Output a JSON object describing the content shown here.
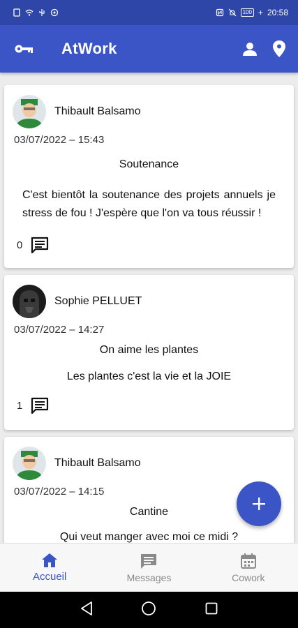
{
  "status_bar": {
    "time": "20:58",
    "battery": "100"
  },
  "app_bar": {
    "title": "AtWork"
  },
  "posts": [
    {
      "author": "Thibault Balsamo",
      "date": "03/07/2022 – 15:43",
      "title": "Soutenance",
      "body": "C'est bientôt la soutenance des projets annuels je stress de fou ! J'espère que l'on va tous réussir !",
      "comment_count": "0"
    },
    {
      "author": "Sophie PELLUET",
      "date": "03/07/2022 – 14:27",
      "title": "On aime les plantes",
      "body": "Les plantes c'est la vie et la JOIE",
      "comment_count": "1"
    },
    {
      "author": "Thibault Balsamo",
      "date": "03/07/2022 – 14:15",
      "title": "Cantine",
      "body": "Qui veut manger avec moi ce midi ?",
      "comment_count": ""
    }
  ],
  "bottom_nav": [
    {
      "label": "Accueil",
      "icon": "home-icon"
    },
    {
      "label": "Messages",
      "icon": "message-icon"
    },
    {
      "label": "Cowork",
      "icon": "calendar-icon"
    }
  ],
  "colors": {
    "primary": "#3b55c7",
    "status_bar": "#2f46a9",
    "inactive": "#8a8a8a"
  }
}
